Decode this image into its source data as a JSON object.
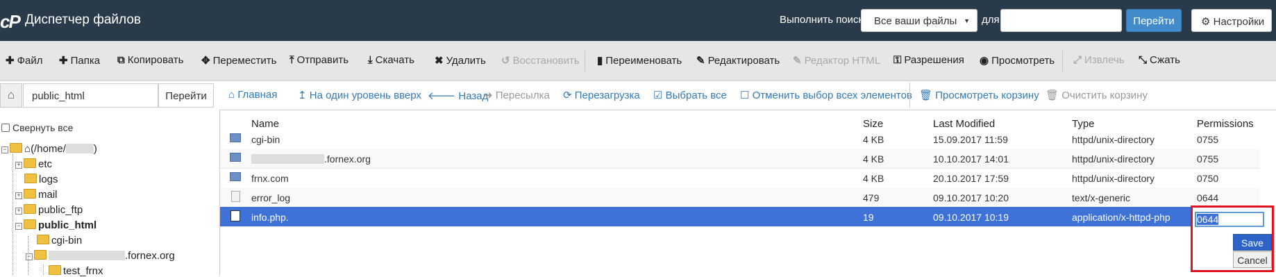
{
  "header": {
    "logo": "cP",
    "title": "Диспетчер файлов",
    "search_label": "Выполнить поиск",
    "search_scope": "Все ваши файлы",
    "for_label": "для",
    "search_value": "",
    "go_label": "Перейти",
    "settings_label": "Настройки"
  },
  "toolbar": {
    "file": "Файл",
    "folder": "Папка",
    "copy": "Копировать",
    "move": "Переместить",
    "upload": "Отправить",
    "download": "Скачать",
    "delete": "Удалить",
    "restore": "Восстановить",
    "rename": "Переименовать",
    "edit": "Редактировать",
    "html_editor": "Редактор HTML",
    "permissions": "Разрешения",
    "view": "Просмотреть",
    "extract": "Извлечь",
    "compress": "Сжать"
  },
  "path": {
    "value": "public_html",
    "go_label": "Перейти"
  },
  "nav": {
    "home": "Главная",
    "up": "На один уровень вверх",
    "back": "Назад",
    "forward": "Пересылка",
    "reload": "Перезагрузка",
    "select_all": "Выбрать все",
    "deselect_all": "Отменить выбор всех элементов",
    "view_trash": "Просмотреть корзину",
    "empty_trash": "Очистить корзину"
  },
  "tree": {
    "collapse_all": "Свернуть все",
    "root_prefix": "(/home/",
    "root_suffix": ")",
    "items": {
      "etc": "etc",
      "logs": "logs",
      "mail": "mail",
      "public_ftp": "public_ftp",
      "public_html": "public_html",
      "cgi_bin": "cgi-bin",
      "domain_suffix": ".fornex.org",
      "test": "test_frnx"
    }
  },
  "table": {
    "headers": {
      "name": "Name",
      "size": "Size",
      "modified": "Last Modified",
      "type": "Type",
      "perms": "Permissions"
    },
    "rows": [
      {
        "name": "cgi-bin",
        "size": "4 KB",
        "modified": "15.09.2017 11:59",
        "type": "httpd/unix-directory",
        "perms": "0755"
      },
      {
        "name": ".fornex.org",
        "size": "4 KB",
        "modified": "10.10.2017 14:01",
        "type": "httpd/unix-directory",
        "perms": "0755"
      },
      {
        "name": "frnx.com",
        "size": "4 KB",
        "modified": "20.10.2017 17:59",
        "type": "httpd/unix-directory",
        "perms": "0750"
      },
      {
        "name": "error_log",
        "size": "479",
        "modified": "09.10.2017 10:20",
        "type": "text/x-generic",
        "perms": "0644"
      },
      {
        "name": "info.php.",
        "size": "19",
        "modified": "09.10.2017 10:19",
        "type": "application/x-httpd-php",
        "perms": ""
      }
    ]
  },
  "perm_edit": {
    "value": "0644",
    "save_label": "Save",
    "cancel_label": "Cancel"
  }
}
